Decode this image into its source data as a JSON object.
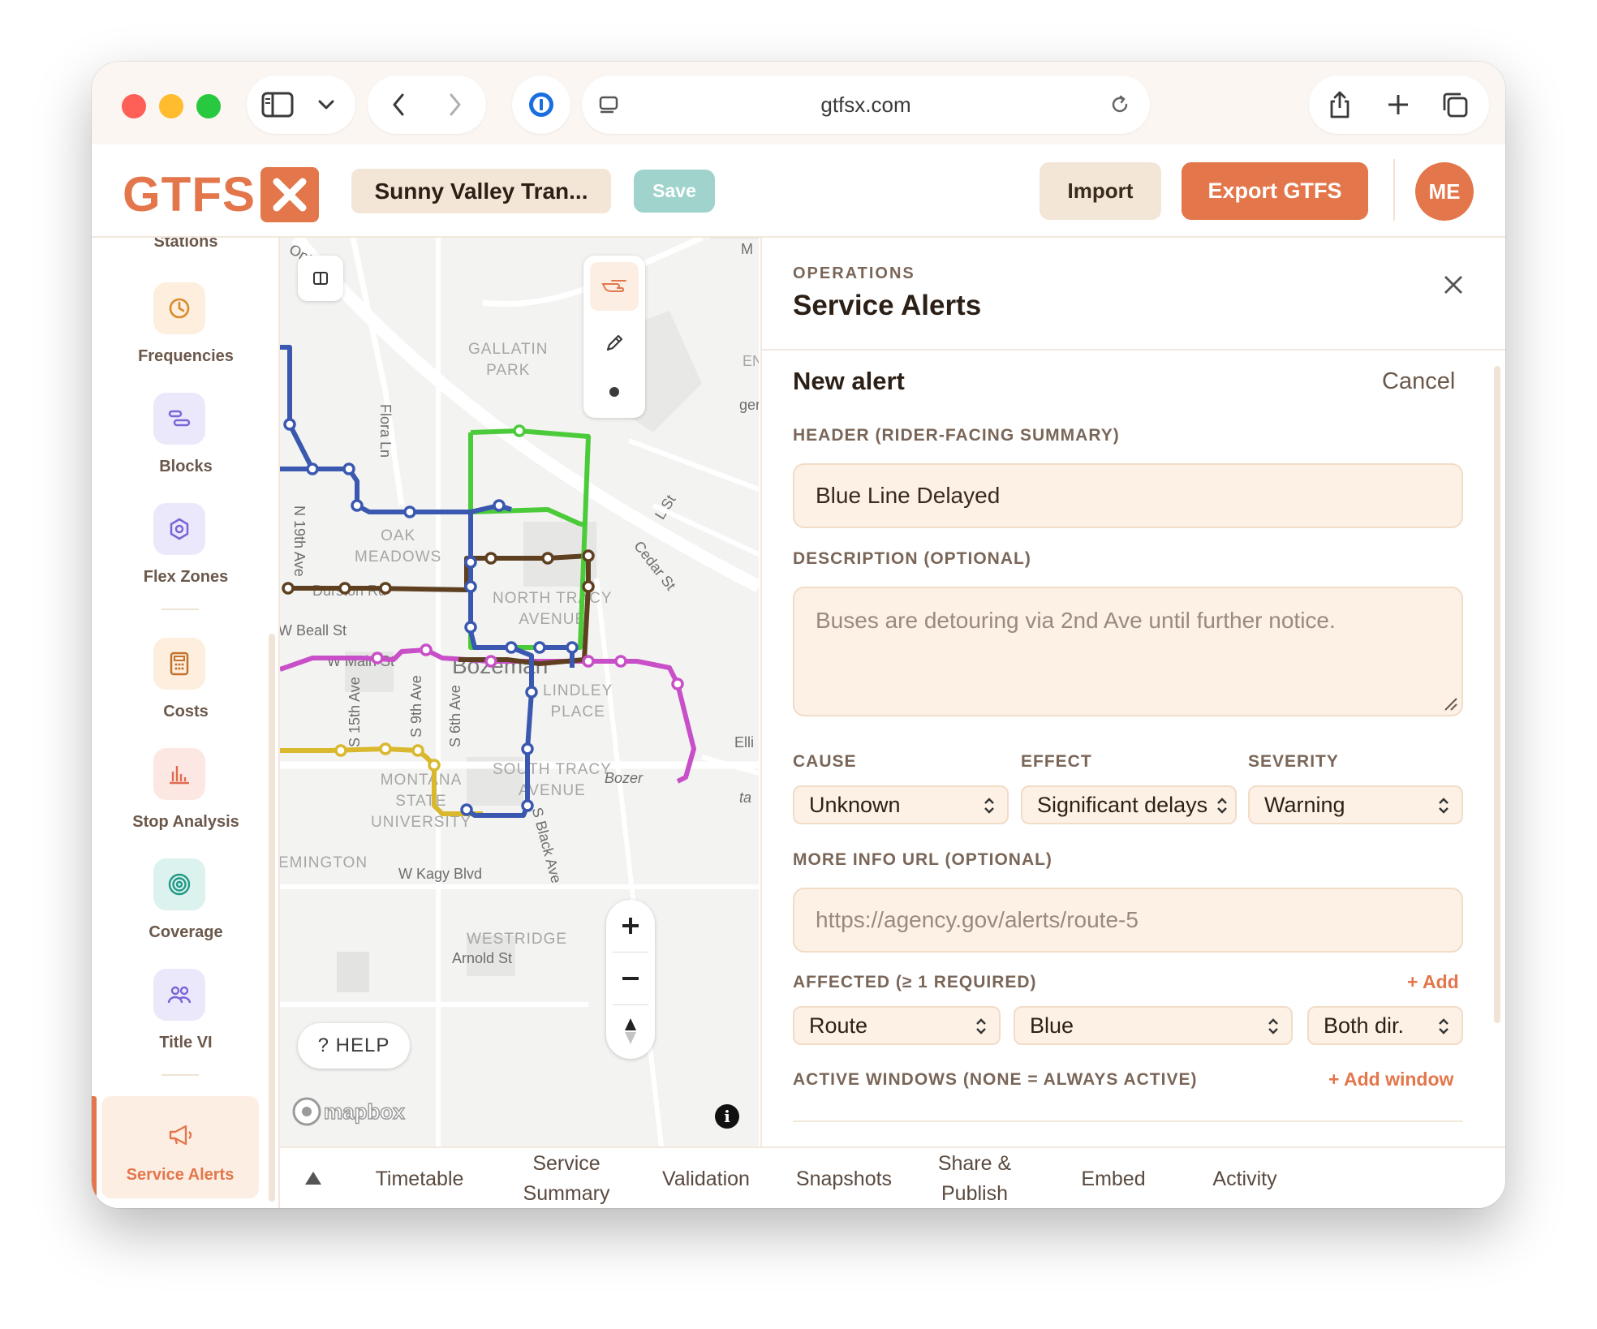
{
  "browser": {
    "url": "gtfsx.com"
  },
  "app": {
    "logo_text": "GTFS",
    "project_name": "Sunny Valley Tran...",
    "save_label": "Save",
    "import_label": "Import",
    "export_label": "Export GTFS",
    "avatar_initials": "ME",
    "brand_color": "#e3764b"
  },
  "sidebar": {
    "items": [
      {
        "label": "Stations",
        "icon": "station-icon"
      },
      {
        "label": "Frequencies",
        "icon": "clock-icon"
      },
      {
        "label": "Blocks",
        "icon": "blocks-icon"
      },
      {
        "label": "Flex Zones",
        "icon": "hexagon-icon"
      },
      {
        "label": "Costs",
        "icon": "calculator-icon"
      },
      {
        "label": "Stop Analysis",
        "icon": "bar-chart-icon"
      },
      {
        "label": "Coverage",
        "icon": "target-icon"
      },
      {
        "label": "Title VI",
        "icon": "people-icon"
      },
      {
        "label": "Service Alerts",
        "icon": "megaphone-icon",
        "active": true
      }
    ]
  },
  "map": {
    "labels": {
      "gallatin_park": "GALLATIN\nPARK",
      "oak_meadows": "OAK\nMEADOWS",
      "north_tracy": "NORTH TRACY\nAVENUE",
      "lindley": "LINDLEY\nPLACE",
      "south_tracy": "SOUTH TRACY\nAVENUE",
      "msu": "MONTANA\nSTATE\nUNIVERSITY",
      "emington": "EMINGTON",
      "westridge": "WESTRIDGE",
      "bozeman": "Bozeman",
      "flora": "Flora Ln",
      "n19": "N 19th Ave",
      "beall": "W Beall St",
      "main": "W Main St",
      "s15": "S 15th Ave",
      "s9": "S 9th Ave",
      "s6": "S 6th Ave",
      "sblack": "S Black Ave",
      "kagy": "W Kagy Blvd",
      "cedar": "Cedar St",
      "lst": "L St",
      "durston": "Durston Rd",
      "arnold": "Arnold St",
      "bozer": "Bozer",
      "elli": "Elli",
      "en": "EN",
      "ger": "ger",
      "ontario": "Ont",
      "m": "M",
      "ta": "ta"
    },
    "help_label": "? HELP",
    "attribution": "mapbox",
    "route_colors": {
      "blue": "#3a58b0",
      "green": "#4ccb3a",
      "brown": "#5e4021",
      "magenta": "#c84fc7",
      "yellow": "#d9b82d"
    }
  },
  "panel": {
    "section": "OPERATIONS",
    "title": "Service Alerts",
    "form_title": "New alert",
    "cancel_label": "Cancel",
    "header_label": "HEADER (RIDER-FACING SUMMARY)",
    "header_value": "Blue Line Delayed",
    "description_label": "DESCRIPTION (OPTIONAL)",
    "description_placeholder": "Buses are detouring via 2nd Ave until further notice.",
    "cause_label": "CAUSE",
    "cause_value": "Unknown",
    "effect_label": "EFFECT",
    "effect_value": "Significant delays",
    "severity_label": "SEVERITY",
    "severity_value": "Warning",
    "url_label": "MORE INFO URL (OPTIONAL)",
    "url_placeholder": "https://agency.gov/alerts/route-5",
    "affected_label": "AFFECTED (≥ 1 REQUIRED)",
    "add_label": "+ Add",
    "affected_type": "Route",
    "affected_route": "Blue",
    "affected_direction": "Both dir.",
    "windows_label": "ACTIVE WINDOWS (NONE = ALWAYS ACTIVE)",
    "add_window_label": "+ Add window"
  },
  "bottombar": {
    "tabs": [
      "Timetable",
      "Service Summary",
      "Validation",
      "Snapshots",
      "Share & Publish",
      "Embed",
      "Activity"
    ]
  }
}
